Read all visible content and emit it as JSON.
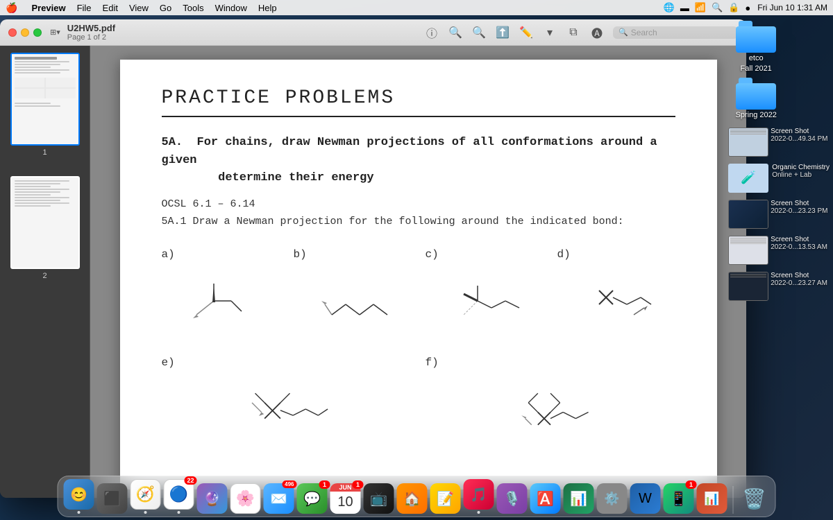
{
  "menubar": {
    "apple": "🍎",
    "items": [
      "Preview",
      "File",
      "Edit",
      "View",
      "Go",
      "Tools",
      "Window",
      "Help"
    ],
    "time": "Fri Jun 10  1:31 AM"
  },
  "window": {
    "title": "U2HW5.pdf",
    "subtitle": "Page 1 of 2"
  },
  "toolbar": {
    "search_placeholder": "Search"
  },
  "document": {
    "title": "PRACTICE PROBLEMS",
    "problem_header": "5A.  For chains, draw Newman projections of all conformations around a given\n         determine their energy",
    "ocsl_text": "OCSL 6.1 – 6.14",
    "problem_5a1": "5A.1  Draw a Newman projection for the following around the indicated bond:",
    "labels": [
      "a)",
      "b)",
      "c)",
      "d)",
      "e)",
      "f)"
    ]
  },
  "desktop": {
    "folder1_label": "etco",
    "folder1_sublabel": "Fall 2021",
    "folder2_label": "Spring 2022",
    "oc_label": "Organic Chemistry\nOnline + Lab",
    "ss1_name": "Screen Shot",
    "ss1_date": "2022-0...49.34 PM",
    "ss2_name": "Screen Shot",
    "ss2_date": "2022-0...23.23 PM",
    "ss3_name": "Screen Shot",
    "ss3_date": "2022-0...13.53 AM",
    "ss4_name": "Screen Shot",
    "ss4_date": "2022-0...23.27 AM"
  },
  "dock": {
    "date_month": "JUN",
    "date_day": "10",
    "apps": [
      {
        "name": "finder",
        "emoji": "🔵",
        "badge": null
      },
      {
        "name": "launchpad",
        "emoji": "🚀",
        "badge": null
      },
      {
        "name": "safari",
        "emoji": "🧭",
        "badge": null
      },
      {
        "name": "chrome",
        "emoji": "🔵",
        "badge": "22"
      },
      {
        "name": "siri",
        "emoji": "🔮",
        "badge": null
      },
      {
        "name": "photos",
        "emoji": "🌸",
        "badge": null
      },
      {
        "name": "mail",
        "emoji": "✉️",
        "badge": "496"
      },
      {
        "name": "messages",
        "emoji": "💬",
        "badge": "1"
      },
      {
        "name": "apple-tv",
        "emoji": "📺",
        "badge": null
      },
      {
        "name": "home",
        "emoji": "🏠",
        "badge": null
      },
      {
        "name": "notes",
        "emoji": "📝",
        "badge": null
      },
      {
        "name": "music",
        "emoji": "🎵",
        "badge": null
      },
      {
        "name": "podcasts",
        "emoji": "🎙️",
        "badge": null
      },
      {
        "name": "app-store",
        "emoji": "🅰️",
        "badge": null
      },
      {
        "name": "excel",
        "emoji": "📊",
        "badge": null
      },
      {
        "name": "unknown1",
        "emoji": "🔮",
        "badge": null
      },
      {
        "name": "word",
        "emoji": "📄",
        "badge": null
      },
      {
        "name": "whatsapp",
        "emoji": "📱",
        "badge": "1"
      },
      {
        "name": "powerpoint",
        "emoji": "📊",
        "badge": null
      },
      {
        "name": "preview",
        "emoji": "🖼️",
        "badge": null
      },
      {
        "name": "trash",
        "emoji": "🗑️",
        "badge": null
      }
    ]
  }
}
